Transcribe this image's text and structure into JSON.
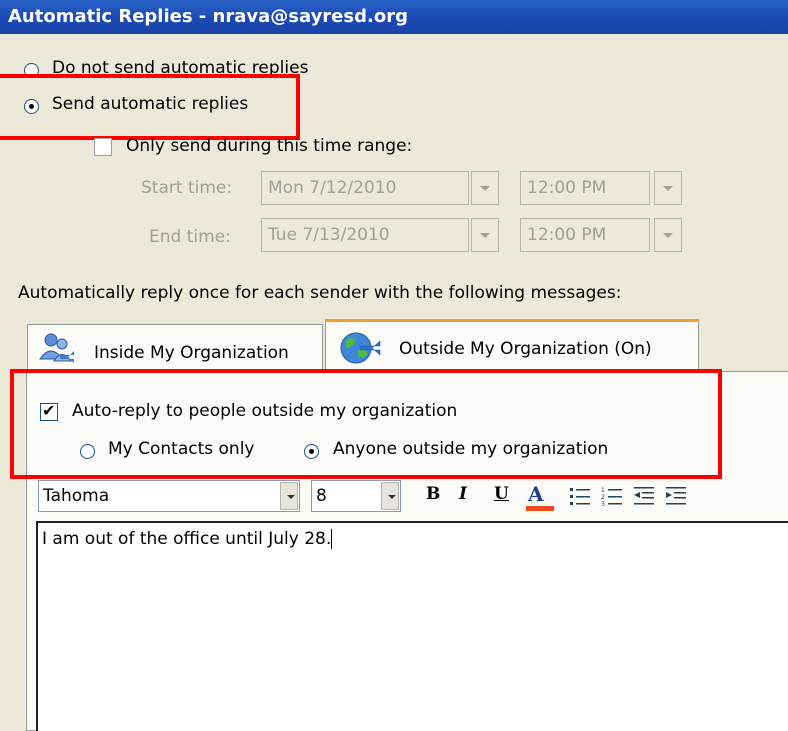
{
  "window": {
    "title": "Automatic Replies - nrava@sayresd.org"
  },
  "mode": {
    "do_not_send_label": "Do not send automatic replies",
    "send_label": "Send automatic replies",
    "selected": "send"
  },
  "time_range": {
    "label": "Only send during this time range:",
    "checked": false,
    "start_label": "Start time:",
    "start_date": "Mon 7/12/2010",
    "start_time": "12:00 PM",
    "end_label": "End time:",
    "end_date": "Tue 7/13/2010",
    "end_time": "12:00 PM"
  },
  "instructions": "Automatically reply once for each sender with the following messages:",
  "tabs": [
    {
      "label": "Inside My Organization",
      "icon": "people-icon",
      "active": false
    },
    {
      "label": "Outside My Organization (On)",
      "icon": "globe-icon",
      "active": true
    }
  ],
  "outside": {
    "autoreply_label": "Auto-reply to people outside my organization",
    "autoreply_checked": true,
    "contacts_only_label": "My Contacts only",
    "anyone_label": "Anyone outside my organization",
    "selected": "anyone"
  },
  "toolbar": {
    "font": "Tahoma",
    "size": "8",
    "bold": "B",
    "italic": "I",
    "underline": "U",
    "color": "A"
  },
  "message": "I am out of the office until July 28.",
  "colors": {
    "highlight": "#ff0000",
    "title_bar": "#1b49b4"
  }
}
